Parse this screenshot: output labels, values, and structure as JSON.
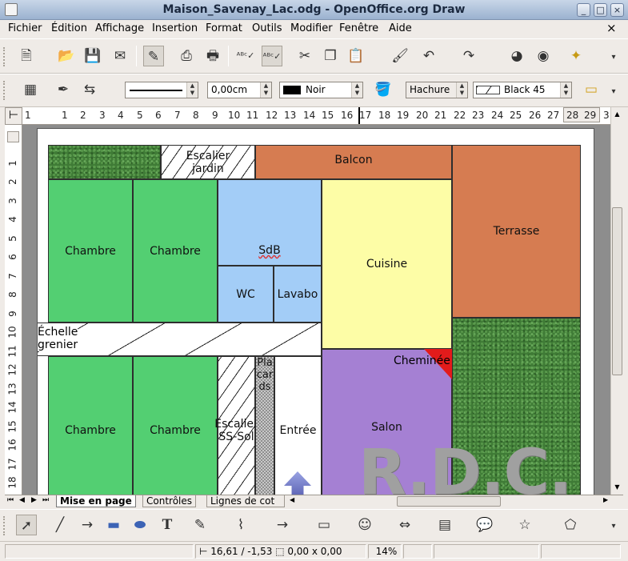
{
  "window": {
    "title": "Maison_Savenay_Lac.odg - OpenOffice.org Draw",
    "min": "_",
    "max": "□",
    "close": "×"
  },
  "menu": [
    "Fichier",
    "Édition",
    "Affichage",
    "Insertion",
    "Format",
    "Outils",
    "Modifier",
    "Fenêtre",
    "Aide"
  ],
  "menu_close": "×",
  "line_format": {
    "width_value": "0,00cm",
    "line_color": "Noir",
    "area_type": "Hachure",
    "area_style": "Black 45"
  },
  "rulers": {
    "corner": "⊢",
    "h": [
      "1",
      "1",
      "2",
      "3",
      "4",
      "5",
      "6",
      "7",
      "8",
      "9",
      "10",
      "11",
      "12",
      "13",
      "14",
      "15",
      "16",
      "17",
      "18",
      "19",
      "20",
      "21",
      "22",
      "23",
      "24",
      "25",
      "26",
      "27",
      "28",
      "29",
      "3"
    ],
    "v": [
      "1",
      "2",
      "3",
      "4",
      "5",
      "6",
      "7",
      "8",
      "9",
      "10",
      "11",
      "12",
      "13",
      "14",
      "15",
      "16",
      "17",
      "18"
    ]
  },
  "plan": {
    "escalier_jardin": "Escalier\njardin",
    "balcon": "Balcon",
    "chambre_1": "Chambre",
    "chambre_2": "Chambre",
    "sdb": "SdB",
    "cuisine": "Cuisine",
    "terrasse": "Terrasse",
    "wc": "WC",
    "lavabo": "Lavabo",
    "echelle": "Échelle\ngrenier",
    "cheminee": "Cheminée",
    "placards": "Pla\ncar\nds",
    "chambre_3": "Chambre",
    "chambre_4": "Chambre",
    "escalier_ss": "Escalier\nSS-Sol",
    "entree": "Entrée",
    "salon": "Salon",
    "rdc": "R.D.C."
  },
  "tabs": [
    "Mise en page",
    "Contrôles",
    "Lignes de cot"
  ],
  "status": {
    "position": "16,61 / -1,53",
    "size": "0,00 x 0,00",
    "zoom": "14%"
  },
  "colors": {
    "green": "#53cf72",
    "blue": "#a3cdf7",
    "yellow": "#fdfda6",
    "orange": "#d67c51",
    "purple": "#a580d3",
    "red": "#e21b1b"
  }
}
